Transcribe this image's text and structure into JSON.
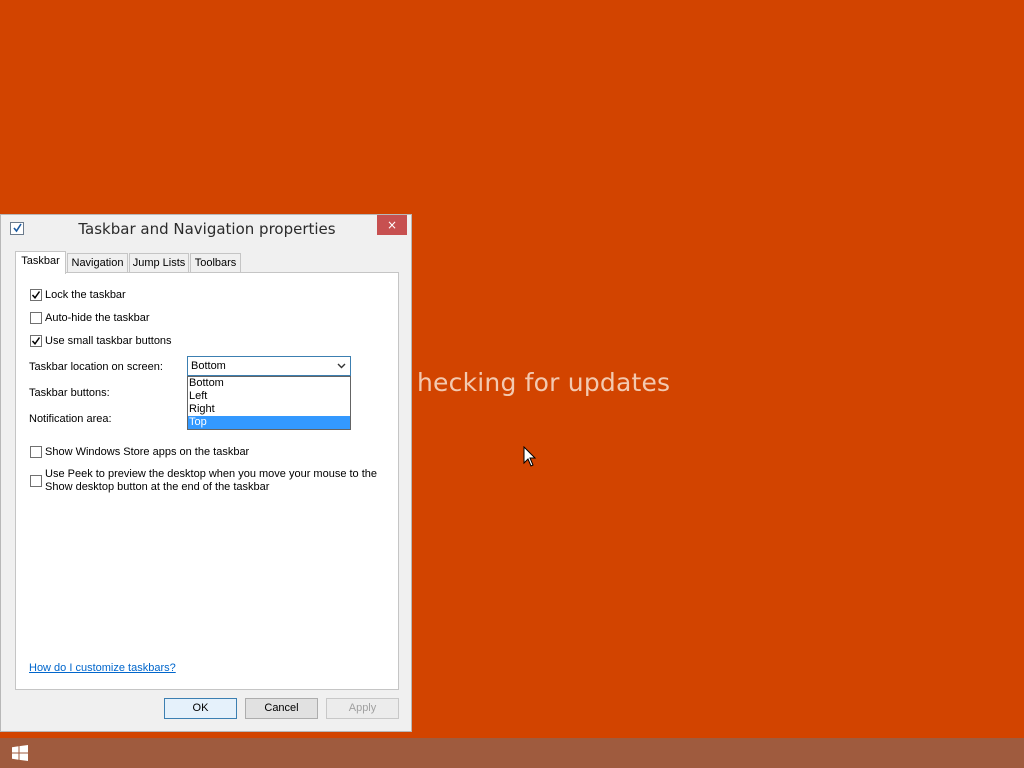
{
  "background": {
    "status_text": "hecking for updates",
    "color": "#d24400"
  },
  "dialog": {
    "title": "Taskbar and Navigation properties",
    "close_icon": "×",
    "tabs": [
      {
        "label": "Taskbar",
        "active": true
      },
      {
        "label": "Navigation",
        "active": false
      },
      {
        "label": "Jump Lists",
        "active": false
      },
      {
        "label": "Toolbars",
        "active": false
      }
    ],
    "options": {
      "lock_taskbar": {
        "label": "Lock the taskbar",
        "checked": true
      },
      "auto_hide": {
        "label": "Auto-hide the taskbar",
        "checked": false
      },
      "small_buttons": {
        "label": "Use small taskbar buttons",
        "checked": true
      },
      "store_apps": {
        "label": "Show Windows Store apps on the taskbar",
        "checked": false
      },
      "peek": {
        "label_line1": "Use Peek to preview the desktop when you move your mouse to the",
        "label_line2": "Show desktop button at the end of the taskbar",
        "checked": false
      }
    },
    "location_label": "Taskbar location on screen:",
    "location_value": "Bottom",
    "location_options": [
      "Bottom",
      "Left",
      "Right",
      "Top"
    ],
    "highlighted_option": "Top",
    "buttons_label": "Taskbar buttons:",
    "notification_label": "Notification area:",
    "help_link": "How do I customize taskbars?",
    "ok_label": "OK",
    "cancel_label": "Cancel",
    "apply_label": "Apply"
  },
  "icons": {
    "start": "windows-logo-icon",
    "cursor": "mouse-pointer-icon",
    "dropdown": "chevron-down-icon"
  },
  "colors": {
    "accent": "#3399ff",
    "close": "#c75050",
    "taskbar": "#9f5b3e"
  }
}
